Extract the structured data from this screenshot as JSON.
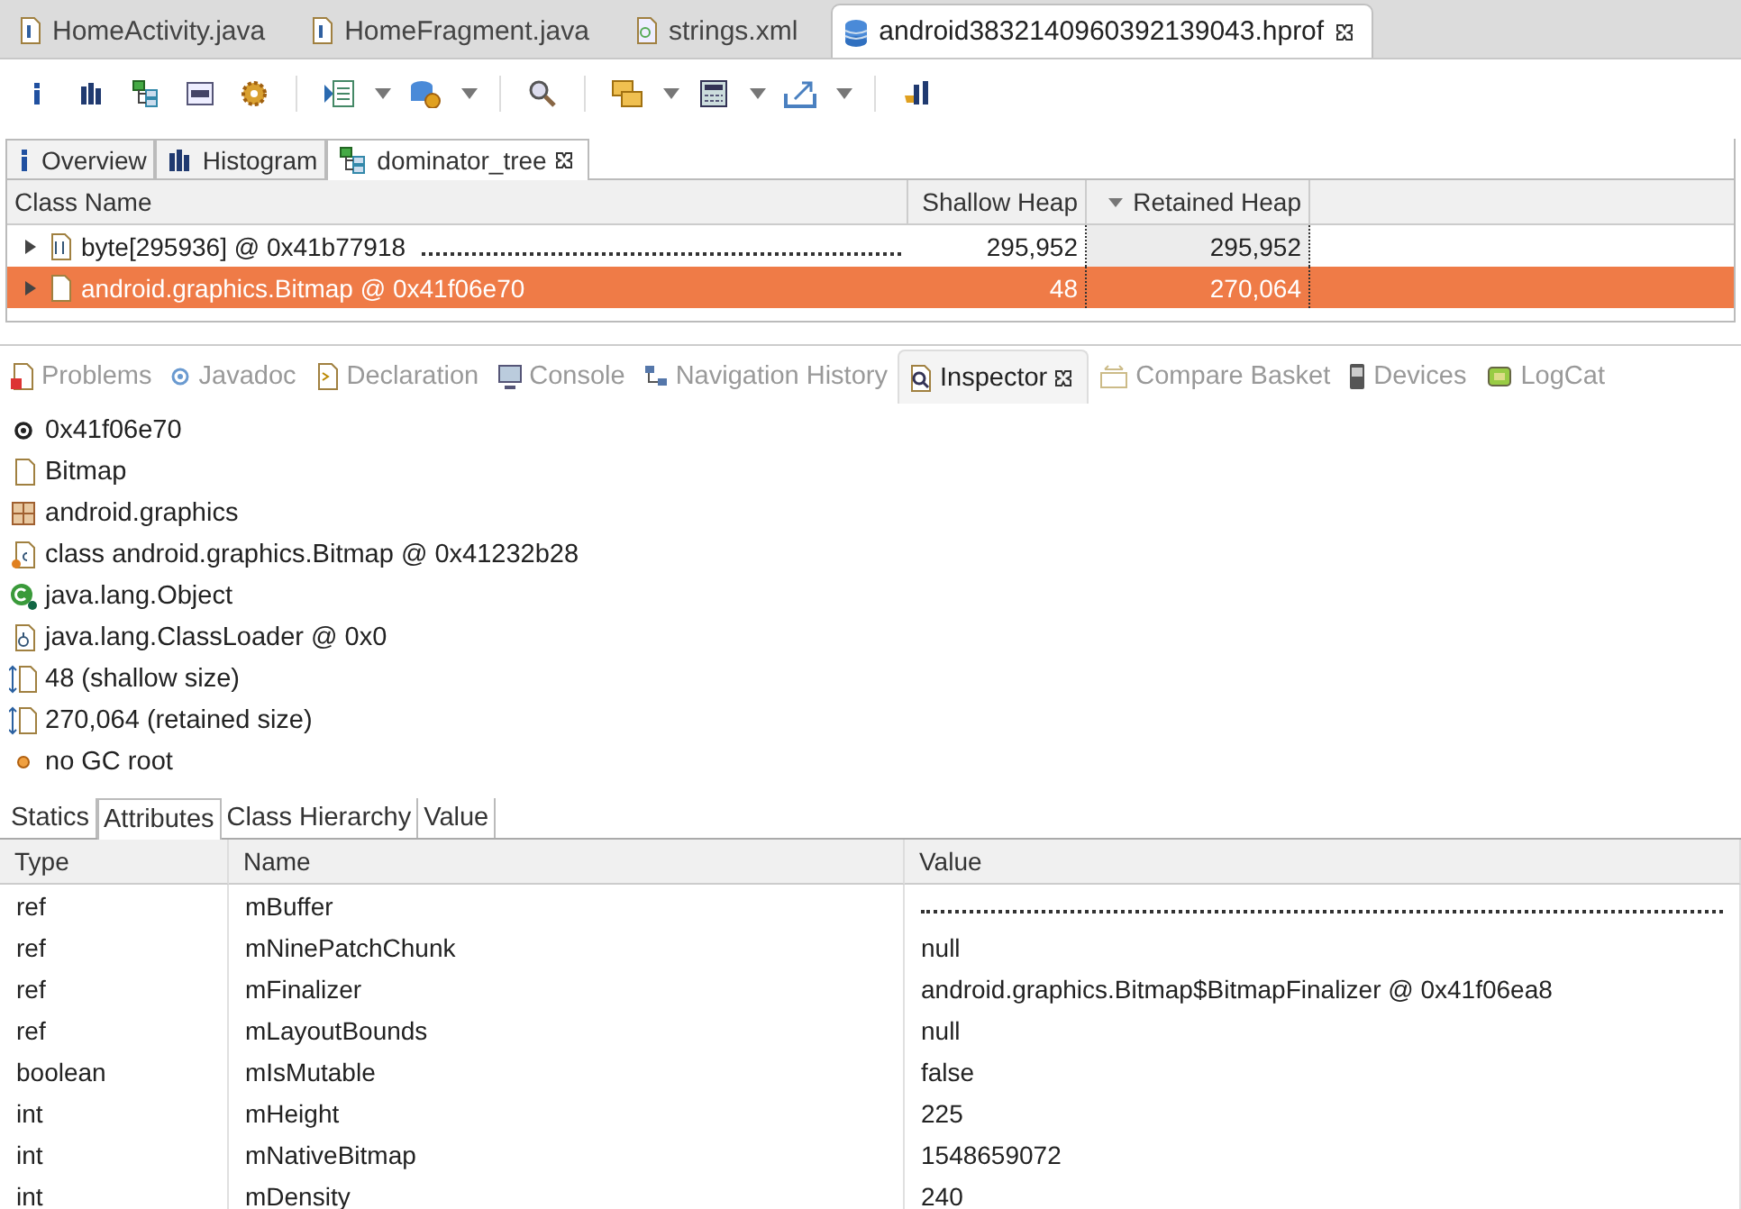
{
  "editor_tabs": [
    {
      "label": "HomeActivity.java",
      "selected": false
    },
    {
      "label": "HomeFragment.java",
      "selected": false
    },
    {
      "label": "strings.xml",
      "selected": false
    },
    {
      "label": "android3832140960392139043.hprof",
      "selected": true
    }
  ],
  "heap_tabs": [
    {
      "label": "Overview",
      "selected": false
    },
    {
      "label": "Histogram",
      "selected": false
    },
    {
      "label": "dominator_tree",
      "selected": true
    }
  ],
  "dominator_table": {
    "columns": [
      {
        "label": "Class Name",
        "sorted": false
      },
      {
        "label": "Shallow Heap",
        "sorted": false
      },
      {
        "label": "Retained Heap",
        "sorted": true
      }
    ],
    "rows": [
      {
        "class_name": "byte[295936] @ 0x41b77918",
        "leader": true,
        "shallow_heap": "295,952",
        "retained_heap": "295,952",
        "selected": false,
        "expanded": false
      },
      {
        "class_name": "android.graphics.Bitmap @ 0x41f06e70",
        "leader": false,
        "shallow_heap": "48",
        "retained_heap": "270,064",
        "selected": true,
        "expanded": false
      }
    ]
  },
  "view_tabs": [
    {
      "label": "Problems",
      "selected": false
    },
    {
      "label": "Javadoc",
      "selected": false
    },
    {
      "label": "Declaration",
      "selected": false
    },
    {
      "label": "Console",
      "selected": false
    },
    {
      "label": "Navigation History",
      "selected": false
    },
    {
      "label": "Inspector",
      "selected": true
    },
    {
      "label": "Compare Basket",
      "selected": false
    },
    {
      "label": "Devices",
      "selected": false
    },
    {
      "label": "LogCat",
      "selected": false
    }
  ],
  "inspector": {
    "items": [
      {
        "text": "0x41f06e70"
      },
      {
        "text": "Bitmap"
      },
      {
        "text": "android.graphics"
      },
      {
        "text": "class android.graphics.Bitmap @ 0x41232b28"
      },
      {
        "text": "java.lang.Object"
      },
      {
        "text": "java.lang.ClassLoader @ 0x0"
      },
      {
        "text": "48 (shallow size)"
      },
      {
        "text": "270,064 (retained size)"
      },
      {
        "text": "no GC root"
      }
    ]
  },
  "inspector_tabs": [
    {
      "label": "Statics",
      "selected": false
    },
    {
      "label": "Attributes",
      "selected": true
    },
    {
      "label": "Class Hierarchy",
      "selected": false
    },
    {
      "label": "Value",
      "selected": false
    }
  ],
  "attributes": {
    "columns": [
      "Type",
      "Name",
      "Value"
    ],
    "rows": [
      {
        "type": "ref",
        "name": "mBuffer",
        "leader": true
      },
      {
        "type": "ref",
        "name": "mNinePatchChunk",
        "value": "null",
        "leader": false
      },
      {
        "type": "ref",
        "name": "mFinalizer",
        "value": "android.graphics.Bitmap$BitmapFinalizer @ 0x41f06ea8",
        "leader": false
      },
      {
        "type": "ref",
        "name": "mLayoutBounds",
        "value": "null",
        "leader": false
      },
      {
        "type": "boolean",
        "name": "mIsMutable",
        "value": "false",
        "leader": false
      },
      {
        "type": "int",
        "name": "mHeight",
        "value": "225",
        "leader": false
      },
      {
        "type": "int",
        "name": "mNativeBitmap",
        "value": "1548659072",
        "leader": false
      },
      {
        "type": "int",
        "name": "mDensity",
        "value": "240",
        "leader": false
      }
    ]
  }
}
